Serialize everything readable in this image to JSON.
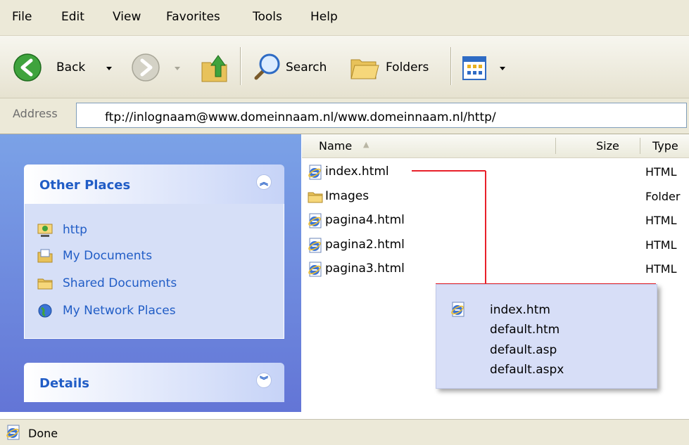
{
  "menu": [
    "File",
    "Edit",
    "View",
    "Favorites",
    "Tools",
    "Help"
  ],
  "toolbar": {
    "back_label": "Back",
    "search_label": "Search",
    "folders_label": "Folders"
  },
  "address": {
    "label": "Address",
    "value": "ftp://inlognaam@www.domeinnaam.nl/www.domeinnaam.nl/http/"
  },
  "taskpane": {
    "other_places": {
      "title": "Other Places",
      "items": [
        "http",
        "My Documents",
        "Shared Documents",
        "My Network Places"
      ]
    },
    "details": {
      "title": "Details"
    }
  },
  "filelist": {
    "columns": {
      "name": "Name",
      "size": "Size",
      "type": "Type"
    },
    "files": [
      {
        "name": "index.html",
        "type": "HTML",
        "icon": "ie-document-icon"
      },
      {
        "name": "Images",
        "type": "Folder",
        "icon": "folder-icon"
      },
      {
        "name": "pagina4.html",
        "type": "HTML",
        "icon": "ie-document-icon"
      },
      {
        "name": "pagina2.html",
        "type": "HTML",
        "icon": "ie-document-icon"
      },
      {
        "name": "pagina3.html",
        "type": "HTML",
        "icon": "ie-document-icon"
      }
    ]
  },
  "callout": {
    "lines": [
      "index.htm",
      "default.htm",
      "default.asp",
      "default.aspx"
    ],
    "line_color": "#e8202a"
  },
  "status": {
    "text": "Done"
  }
}
